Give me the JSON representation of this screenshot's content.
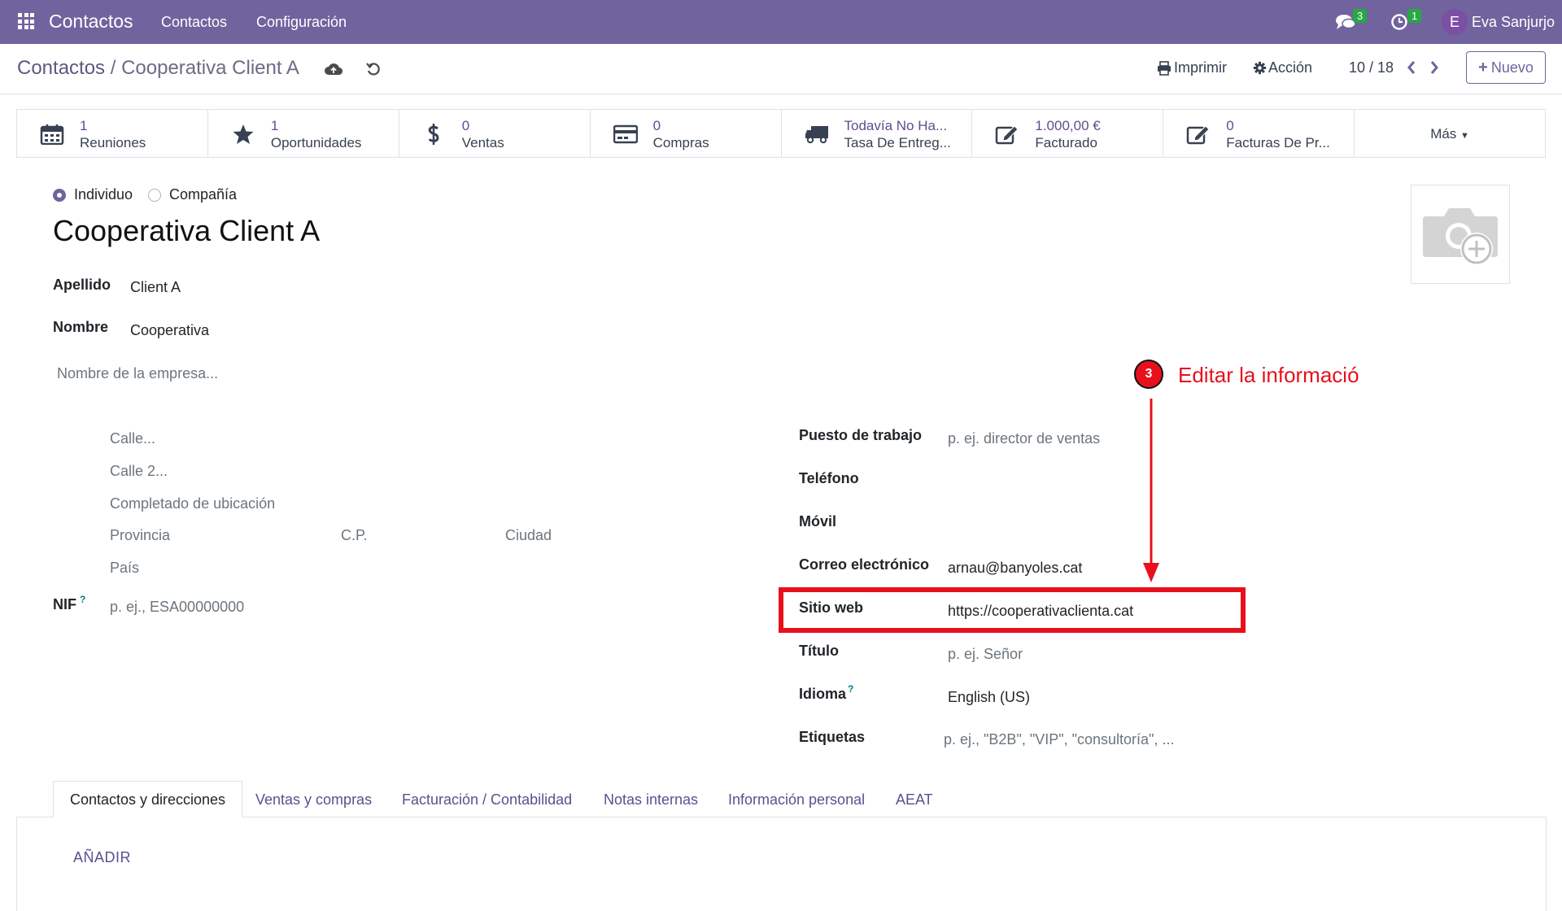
{
  "navbar": {
    "app_name": "Contactos",
    "menu": [
      "Contactos",
      "Configuración"
    ],
    "messages_count": "3",
    "activities_count": "1",
    "user_initial": "E",
    "user_name": "Eva Sanjurjo",
    "color": "#71639e"
  },
  "control_panel": {
    "breadcrumb_root": "Contactos",
    "breadcrumb_sep": "/",
    "breadcrumb_current": "Cooperativa Client A",
    "print_label": "Imprimir",
    "action_label": "Acción",
    "pager": "10 / 18",
    "new_label": "Nuevo"
  },
  "smart_buttons": [
    {
      "value": "1",
      "label": "Reuniones",
      "icon": "calendar-icon"
    },
    {
      "value": "1",
      "label": "Oportunidades",
      "icon": "star-icon"
    },
    {
      "value": "0",
      "label": "Ventas",
      "icon": "dollar-icon"
    },
    {
      "value": "0",
      "label": "Compras",
      "icon": "credit-card-icon"
    },
    {
      "value": "Todavía No Ha...",
      "label": "Tasa De Entreg...",
      "icon": "truck-icon"
    },
    {
      "value": "1.000,00 €",
      "label": "Facturado",
      "icon": "edit-icon"
    },
    {
      "value": "0",
      "label": "Facturas De Pr...",
      "icon": "edit-icon"
    }
  ],
  "more_label": "Más",
  "form": {
    "type_individual": "Individuo",
    "type_company": "Compañía",
    "selected_type": "Individuo",
    "title": "Cooperativa Client A",
    "apellido_label": "Apellido",
    "apellido_value": "Client A",
    "nombre_label": "Nombre",
    "nombre_value": "Cooperativa",
    "company_placeholder": "Nombre de la empresa...",
    "street_placeholder": "Calle...",
    "street2_placeholder": "Calle 2...",
    "location_placeholder": "Completado de ubicación",
    "state_placeholder": "Provincia",
    "zip_placeholder": "C.P.",
    "city_placeholder": "Ciudad",
    "country_placeholder": "País",
    "vat_label": "NIF",
    "vat_placeholder": "p. ej., ESA00000000",
    "job_label": "Puesto de trabajo",
    "job_placeholder": "p. ej. director de ventas",
    "phone_label": "Teléfono",
    "mobile_label": "Móvil",
    "email_label": "Correo electrónico",
    "email_value": "arnau@banyoles.cat",
    "website_label": "Sitio web",
    "website_value": "https://cooperativaclienta.cat",
    "title_label": "Título",
    "title_placeholder": "p. ej. Señor",
    "language_label": "Idioma",
    "language_value": "English (US)",
    "tags_label": "Etiquetas",
    "tags_placeholder": "p. ej., \"B2B\", \"VIP\", \"consultoría\", ...",
    "help_mark": "?"
  },
  "annotation": {
    "step": "3",
    "text": "Editar la informació",
    "color": "#e8101c"
  },
  "tabs": [
    "Contactos y direcciones",
    "Ventas y compras",
    "Facturación / Contabilidad",
    "Notas internas",
    "Información personal",
    "AEAT"
  ],
  "active_tab": "Contactos y direcciones",
  "add_label": "AÑADIR"
}
